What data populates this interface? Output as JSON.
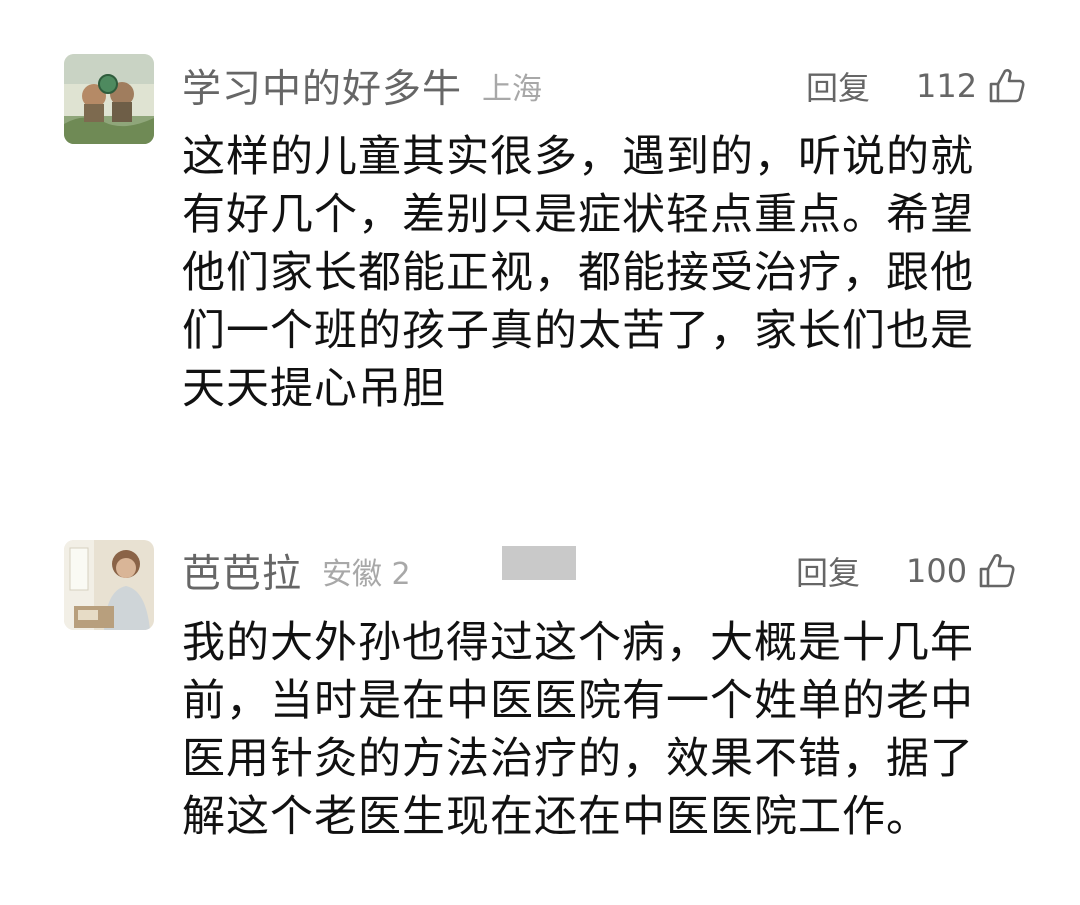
{
  "comments": [
    {
      "username": "学习中的好多牛",
      "location": "上海",
      "reply_label": "回复",
      "likes": "112",
      "like_icon": "thumbs-up-icon",
      "text": "这样的儿童其实很多，遇到的，听说的就有好几个，差别只是症状轻点重点。希望他们家长都能正视，都能接受治疗，跟他们一个班的孩子真的太苦了，家长们也是天天提心吊胆"
    },
    {
      "username": "芭芭拉",
      "location": "安徽 2",
      "reply_label": "回复",
      "likes": "100",
      "like_icon": "thumbs-up-icon",
      "text": "我的大外孙也得过这个病，大概是十几年前，当时是在中医医院有一个姓单的老中医用针灸的方法治疗的，效果不错，据了解这个老医生现在还在中医医院工作。"
    }
  ],
  "colors": {
    "username": "#666666",
    "location": "#a8a8a8",
    "body_text": "#111111",
    "redaction": "#c9c9c9"
  }
}
